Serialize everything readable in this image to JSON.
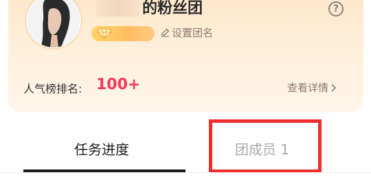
{
  "header": {
    "group_name": "的粉丝团",
    "set_name_label": "设置团名"
  },
  "ranking": {
    "label": "人气榜排名:",
    "value": "100+",
    "details_link": "查看详情"
  },
  "tabs": [
    {
      "label": "任务进度",
      "active": true
    },
    {
      "label": "团成员 1",
      "active": false
    }
  ],
  "colors": {
    "accent": "#f2385a",
    "highlight": "#ee2d2d",
    "badge": "#ffc563"
  },
  "icons": {
    "help": "question-circle-icon",
    "edit": "pencil-icon",
    "gem": "gem-icon",
    "chevron": "chevron-right-icon"
  }
}
